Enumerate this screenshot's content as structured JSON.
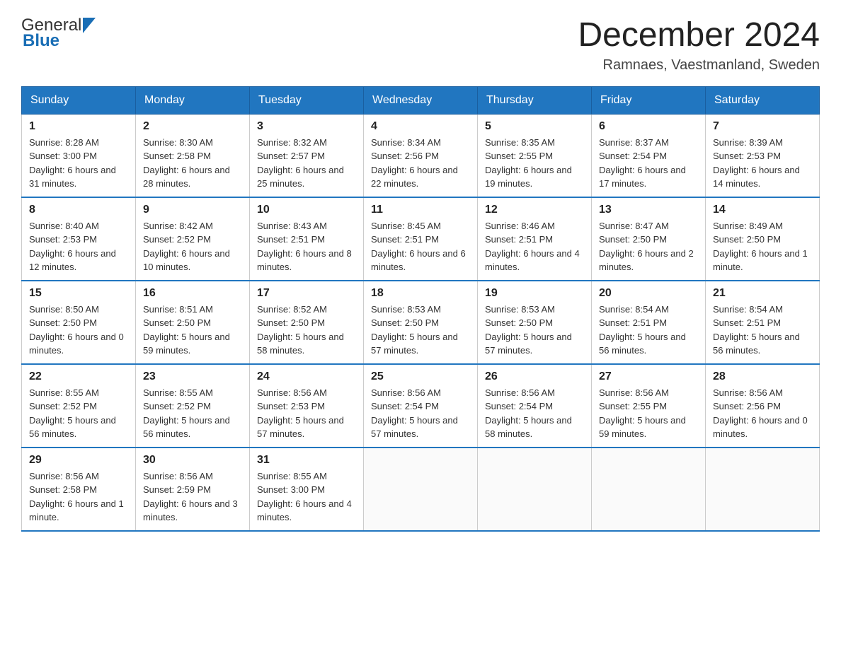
{
  "logo": {
    "general": "General",
    "blue": "Blue"
  },
  "title": "December 2024",
  "subtitle": "Ramnaes, Vaestmanland, Sweden",
  "days_of_week": [
    "Sunday",
    "Monday",
    "Tuesday",
    "Wednesday",
    "Thursday",
    "Friday",
    "Saturday"
  ],
  "weeks": [
    [
      {
        "num": "1",
        "sunrise": "8:28 AM",
        "sunset": "3:00 PM",
        "daylight": "6 hours and 31 minutes."
      },
      {
        "num": "2",
        "sunrise": "8:30 AM",
        "sunset": "2:58 PM",
        "daylight": "6 hours and 28 minutes."
      },
      {
        "num": "3",
        "sunrise": "8:32 AM",
        "sunset": "2:57 PM",
        "daylight": "6 hours and 25 minutes."
      },
      {
        "num": "4",
        "sunrise": "8:34 AM",
        "sunset": "2:56 PM",
        "daylight": "6 hours and 22 minutes."
      },
      {
        "num": "5",
        "sunrise": "8:35 AM",
        "sunset": "2:55 PM",
        "daylight": "6 hours and 19 minutes."
      },
      {
        "num": "6",
        "sunrise": "8:37 AM",
        "sunset": "2:54 PM",
        "daylight": "6 hours and 17 minutes."
      },
      {
        "num": "7",
        "sunrise": "8:39 AM",
        "sunset": "2:53 PM",
        "daylight": "6 hours and 14 minutes."
      }
    ],
    [
      {
        "num": "8",
        "sunrise": "8:40 AM",
        "sunset": "2:53 PM",
        "daylight": "6 hours and 12 minutes."
      },
      {
        "num": "9",
        "sunrise": "8:42 AM",
        "sunset": "2:52 PM",
        "daylight": "6 hours and 10 minutes."
      },
      {
        "num": "10",
        "sunrise": "8:43 AM",
        "sunset": "2:51 PM",
        "daylight": "6 hours and 8 minutes."
      },
      {
        "num": "11",
        "sunrise": "8:45 AM",
        "sunset": "2:51 PM",
        "daylight": "6 hours and 6 minutes."
      },
      {
        "num": "12",
        "sunrise": "8:46 AM",
        "sunset": "2:51 PM",
        "daylight": "6 hours and 4 minutes."
      },
      {
        "num": "13",
        "sunrise": "8:47 AM",
        "sunset": "2:50 PM",
        "daylight": "6 hours and 2 minutes."
      },
      {
        "num": "14",
        "sunrise": "8:49 AM",
        "sunset": "2:50 PM",
        "daylight": "6 hours and 1 minute."
      }
    ],
    [
      {
        "num": "15",
        "sunrise": "8:50 AM",
        "sunset": "2:50 PM",
        "daylight": "6 hours and 0 minutes."
      },
      {
        "num": "16",
        "sunrise": "8:51 AM",
        "sunset": "2:50 PM",
        "daylight": "5 hours and 59 minutes."
      },
      {
        "num": "17",
        "sunrise": "8:52 AM",
        "sunset": "2:50 PM",
        "daylight": "5 hours and 58 minutes."
      },
      {
        "num": "18",
        "sunrise": "8:53 AM",
        "sunset": "2:50 PM",
        "daylight": "5 hours and 57 minutes."
      },
      {
        "num": "19",
        "sunrise": "8:53 AM",
        "sunset": "2:50 PM",
        "daylight": "5 hours and 57 minutes."
      },
      {
        "num": "20",
        "sunrise": "8:54 AM",
        "sunset": "2:51 PM",
        "daylight": "5 hours and 56 minutes."
      },
      {
        "num": "21",
        "sunrise": "8:54 AM",
        "sunset": "2:51 PM",
        "daylight": "5 hours and 56 minutes."
      }
    ],
    [
      {
        "num": "22",
        "sunrise": "8:55 AM",
        "sunset": "2:52 PM",
        "daylight": "5 hours and 56 minutes."
      },
      {
        "num": "23",
        "sunrise": "8:55 AM",
        "sunset": "2:52 PM",
        "daylight": "5 hours and 56 minutes."
      },
      {
        "num": "24",
        "sunrise": "8:56 AM",
        "sunset": "2:53 PM",
        "daylight": "5 hours and 57 minutes."
      },
      {
        "num": "25",
        "sunrise": "8:56 AM",
        "sunset": "2:54 PM",
        "daylight": "5 hours and 57 minutes."
      },
      {
        "num": "26",
        "sunrise": "8:56 AM",
        "sunset": "2:54 PM",
        "daylight": "5 hours and 58 minutes."
      },
      {
        "num": "27",
        "sunrise": "8:56 AM",
        "sunset": "2:55 PM",
        "daylight": "5 hours and 59 minutes."
      },
      {
        "num": "28",
        "sunrise": "8:56 AM",
        "sunset": "2:56 PM",
        "daylight": "6 hours and 0 minutes."
      }
    ],
    [
      {
        "num": "29",
        "sunrise": "8:56 AM",
        "sunset": "2:58 PM",
        "daylight": "6 hours and 1 minute."
      },
      {
        "num": "30",
        "sunrise": "8:56 AM",
        "sunset": "2:59 PM",
        "daylight": "6 hours and 3 minutes."
      },
      {
        "num": "31",
        "sunrise": "8:55 AM",
        "sunset": "3:00 PM",
        "daylight": "6 hours and 4 minutes."
      },
      null,
      null,
      null,
      null
    ]
  ],
  "labels": {
    "sunrise": "Sunrise:",
    "sunset": "Sunset:",
    "daylight": "Daylight:"
  }
}
